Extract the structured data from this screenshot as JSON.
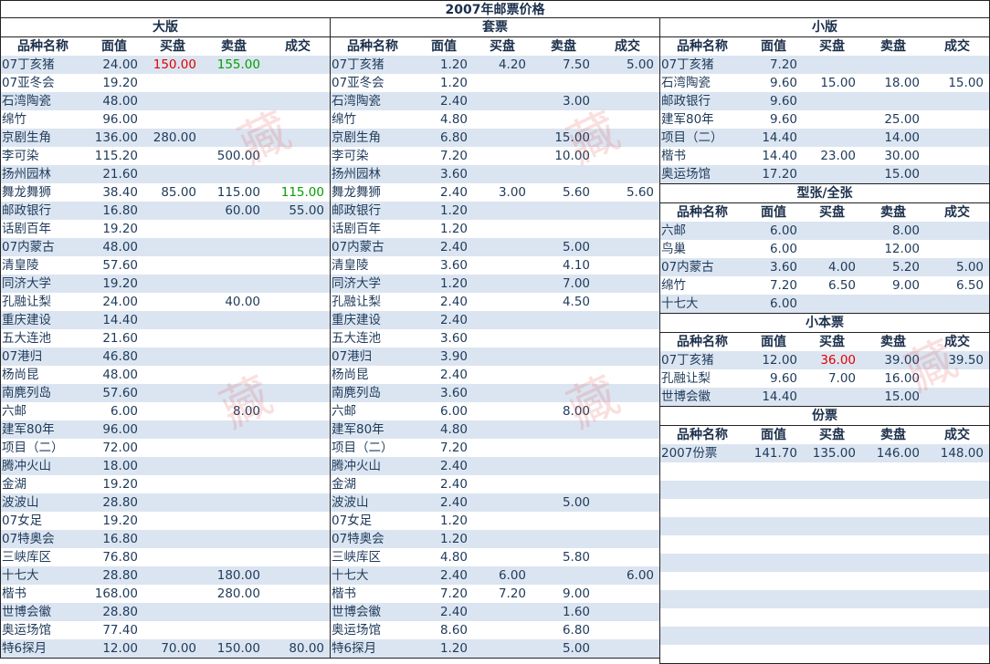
{
  "title": "2007年邮票价格",
  "headers": [
    "品种名称",
    "面值",
    "买盘",
    "卖盘",
    "成交"
  ],
  "sections": {
    "daban": {
      "title": "大版",
      "rows": [
        [
          "07丁亥猪",
          "24.00",
          "150.00",
          "155.00",
          ""
        ],
        [
          "07亚冬会",
          "19.20",
          "",
          "",
          ""
        ],
        [
          "石湾陶瓷",
          "48.00",
          "",
          "",
          ""
        ],
        [
          "绵竹",
          "96.00",
          "",
          "",
          ""
        ],
        [
          "京剧生角",
          "136.00",
          "280.00",
          "",
          ""
        ],
        [
          "李可染",
          "115.20",
          "",
          "500.00",
          ""
        ],
        [
          "扬州园林",
          "21.60",
          "",
          "",
          ""
        ],
        [
          "舞龙舞狮",
          "38.40",
          "85.00",
          "115.00",
          "115.00"
        ],
        [
          "邮政银行",
          "16.80",
          "",
          "60.00",
          "55.00"
        ],
        [
          "话剧百年",
          "19.20",
          "",
          "",
          ""
        ],
        [
          "07内蒙古",
          "48.00",
          "",
          "",
          ""
        ],
        [
          "清皇陵",
          "57.60",
          "",
          "",
          ""
        ],
        [
          "同济大学",
          "19.20",
          "",
          "",
          ""
        ],
        [
          "孔融让梨",
          "24.00",
          "",
          "40.00",
          ""
        ],
        [
          "重庆建设",
          "14.40",
          "",
          "",
          ""
        ],
        [
          "五大连池",
          "21.60",
          "",
          "",
          ""
        ],
        [
          "07港归",
          "46.80",
          "",
          "",
          ""
        ],
        [
          "杨尚昆",
          "48.00",
          "",
          "",
          ""
        ],
        [
          "南麂列岛",
          "57.60",
          "",
          "",
          ""
        ],
        [
          "六邮",
          "6.00",
          "",
          "8.00",
          ""
        ],
        [
          "建军80年",
          "96.00",
          "",
          "",
          ""
        ],
        [
          "项目（二）",
          "72.00",
          "",
          "",
          ""
        ],
        [
          "腾冲火山",
          "18.00",
          "",
          "",
          ""
        ],
        [
          "金湖",
          "19.20",
          "",
          "",
          ""
        ],
        [
          "波波山",
          "28.80",
          "",
          "",
          ""
        ],
        [
          "07女足",
          "19.20",
          "",
          "",
          ""
        ],
        [
          "07特奥会",
          "16.80",
          "",
          "",
          ""
        ],
        [
          "三峡库区",
          "76.80",
          "",
          "",
          ""
        ],
        [
          "十七大",
          "28.80",
          "",
          "180.00",
          ""
        ],
        [
          "楷书",
          "168.00",
          "",
          "280.00",
          ""
        ],
        [
          "世博会徽",
          "28.80",
          "",
          "",
          ""
        ],
        [
          "奥运场馆",
          "77.40",
          "",
          "",
          ""
        ],
        [
          "特6探月",
          "12.00",
          "70.00",
          "150.00",
          "80.00"
        ]
      ]
    },
    "taopiao": {
      "title": "套票",
      "rows": [
        [
          "07丁亥猪",
          "1.20",
          "4.20",
          "7.50",
          "5.00"
        ],
        [
          "07亚冬会",
          "1.20",
          "",
          "",
          ""
        ],
        [
          "石湾陶瓷",
          "2.40",
          "",
          "3.00",
          ""
        ],
        [
          "绵竹",
          "4.80",
          "",
          "",
          ""
        ],
        [
          "京剧生角",
          "6.80",
          "",
          "15.00",
          ""
        ],
        [
          "李可染",
          "7.20",
          "",
          "10.00",
          ""
        ],
        [
          "扬州园林",
          "3.60",
          "",
          "",
          ""
        ],
        [
          "舞龙舞狮",
          "2.40",
          "3.00",
          "5.60",
          "5.60"
        ],
        [
          "邮政银行",
          "1.20",
          "",
          "",
          ""
        ],
        [
          "话剧百年",
          "1.20",
          "",
          "",
          ""
        ],
        [
          "07内蒙古",
          "2.40",
          "",
          "5.00",
          ""
        ],
        [
          "清皇陵",
          "3.60",
          "",
          "4.10",
          ""
        ],
        [
          "同济大学",
          "1.20",
          "",
          "7.00",
          ""
        ],
        [
          "孔融让梨",
          "2.40",
          "",
          "4.50",
          ""
        ],
        [
          "重庆建设",
          "2.40",
          "",
          "",
          ""
        ],
        [
          "五大连池",
          "3.60",
          "",
          "",
          ""
        ],
        [
          "07港归",
          "3.90",
          "",
          "",
          ""
        ],
        [
          "杨尚昆",
          "2.40",
          "",
          "",
          ""
        ],
        [
          "南麂列岛",
          "3.60",
          "",
          "",
          ""
        ],
        [
          "六邮",
          "6.00",
          "",
          "8.00",
          ""
        ],
        [
          "建军80年",
          "4.80",
          "",
          "",
          ""
        ],
        [
          "项目（二）",
          "7.20",
          "",
          "",
          ""
        ],
        [
          "腾冲火山",
          "2.40",
          "",
          "",
          ""
        ],
        [
          "金湖",
          "2.40",
          "",
          "",
          ""
        ],
        [
          "波波山",
          "2.40",
          "",
          "5.00",
          ""
        ],
        [
          "07女足",
          "1.20",
          "",
          "",
          ""
        ],
        [
          "07特奥会",
          "1.20",
          "",
          "",
          ""
        ],
        [
          "三峡库区",
          "4.80",
          "",
          "5.80",
          ""
        ],
        [
          "十七大",
          "2.40",
          "6.00",
          "",
          "6.00"
        ],
        [
          "楷书",
          "7.20",
          "7.20",
          "9.00",
          ""
        ],
        [
          "世博会徽",
          "2.40",
          "",
          "1.60",
          ""
        ],
        [
          "奥运场馆",
          "8.60",
          "",
          "6.80",
          ""
        ],
        [
          "特6探月",
          "1.20",
          "",
          "5.00",
          ""
        ]
      ]
    },
    "xiaoban": {
      "title": "小版",
      "rows": [
        [
          "07丁亥猪",
          "7.20",
          "",
          "",
          ""
        ],
        [
          "石湾陶瓷",
          "9.60",
          "15.00",
          "18.00",
          "15.00"
        ],
        [
          "邮政银行",
          "9.60",
          "",
          "",
          ""
        ],
        [
          "建军80年",
          "9.60",
          "",
          "25.00",
          ""
        ],
        [
          "项目（二）",
          "14.40",
          "",
          "14.00",
          ""
        ],
        [
          "楷书",
          "14.40",
          "23.00",
          "30.00",
          ""
        ],
        [
          "奥运场馆",
          "17.20",
          "",
          "15.00",
          ""
        ]
      ]
    },
    "xingzhang": {
      "title": "型张/全张",
      "rows": [
        [
          "六邮",
          "6.00",
          "",
          "8.00",
          ""
        ],
        [
          "鸟巢",
          "6.00",
          "",
          "12.00",
          ""
        ],
        [
          "07内蒙古",
          "3.60",
          "4.00",
          "5.20",
          "5.00"
        ],
        [
          "绵竹",
          "7.20",
          "6.50",
          "9.00",
          "6.50"
        ],
        [
          "十七大",
          "6.00",
          "",
          "",
          ""
        ]
      ]
    },
    "xiaobenpiao": {
      "title": "小本票",
      "rows": [
        [
          "07丁亥猪",
          "12.00",
          "36.00",
          "39.00",
          "39.50"
        ],
        [
          "孔融让梨",
          "9.60",
          "7.00",
          "16.00",
          ""
        ],
        [
          "世博会徽",
          "14.40",
          "",
          "15.00",
          ""
        ]
      ]
    },
    "fenpiao": {
      "title": "份票",
      "rows": [
        [
          "2007份票",
          "141.70",
          "135.00",
          "146.00",
          "148.00"
        ]
      ]
    }
  },
  "highlights": {
    "red": "#e00000",
    "green": "#00a000",
    "stripe": "#dbe5f1"
  },
  "watermark": "藏"
}
